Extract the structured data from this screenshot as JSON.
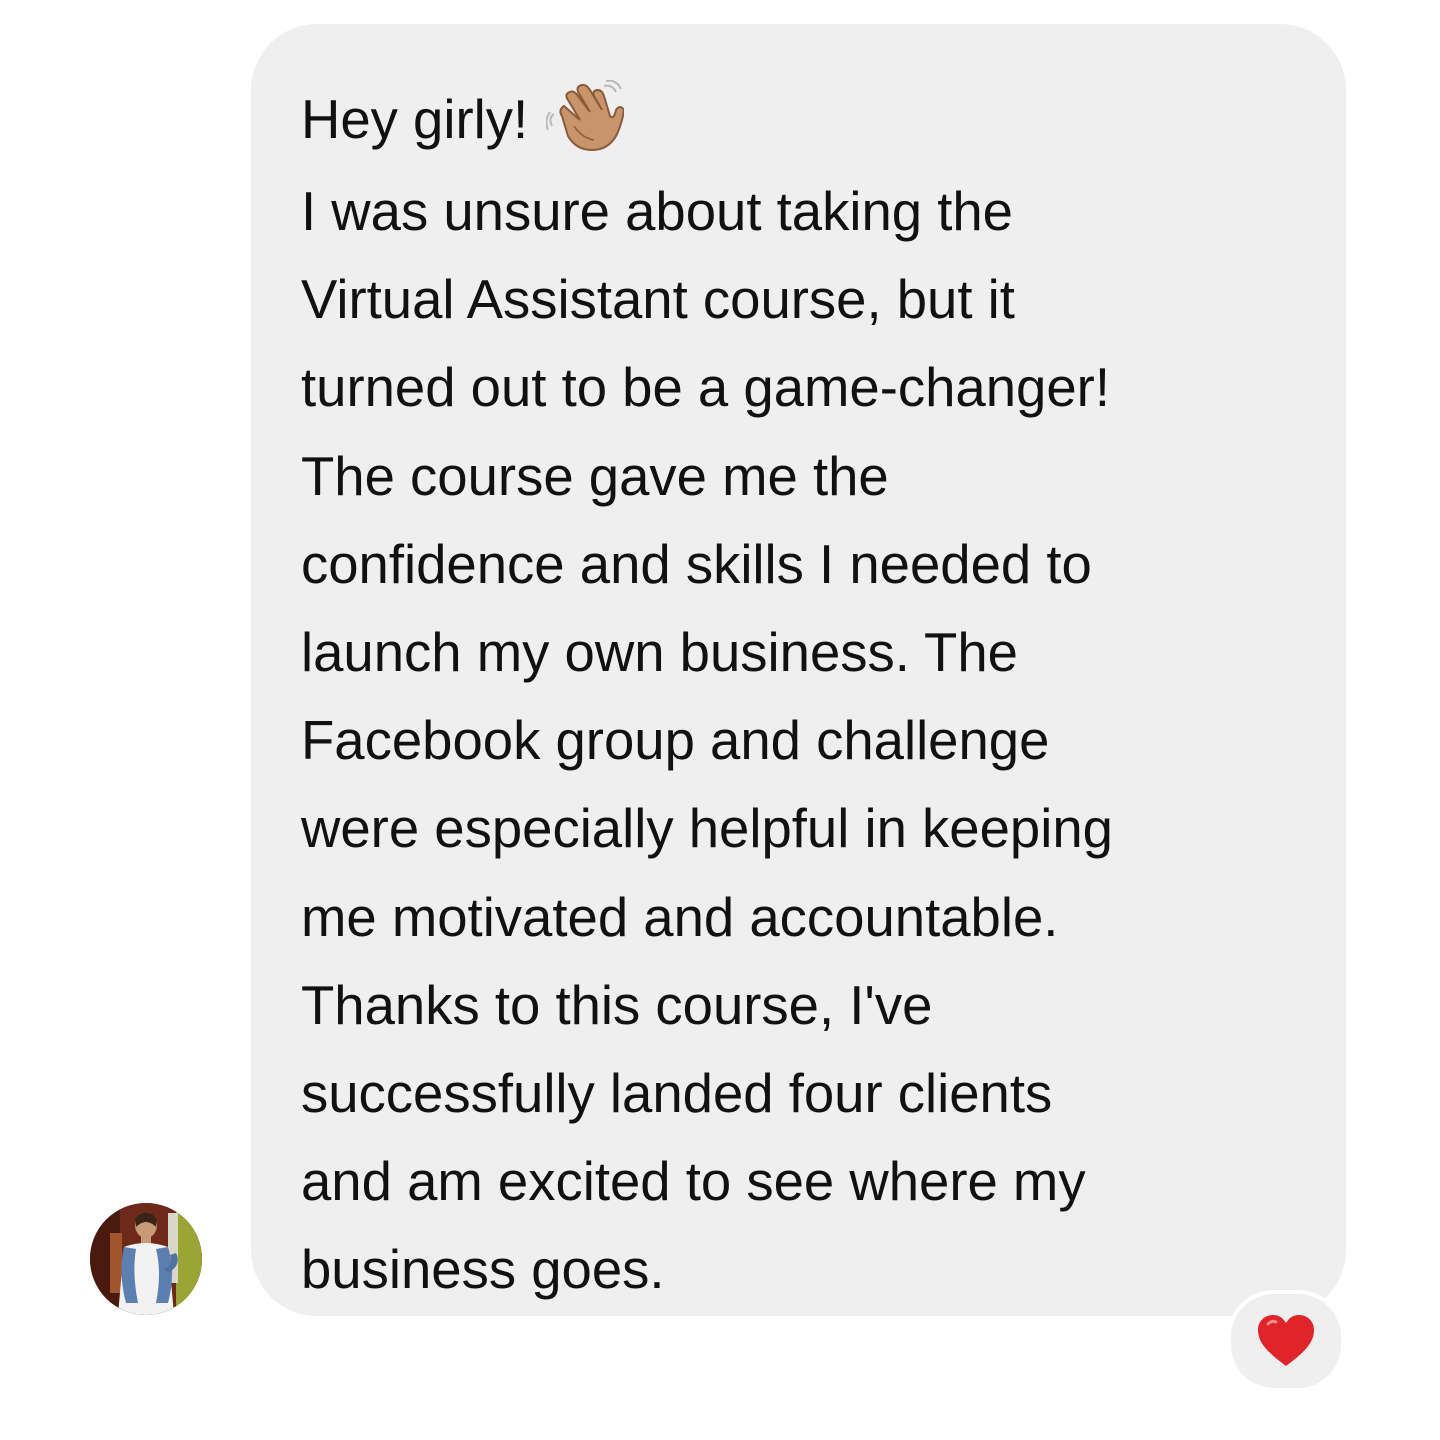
{
  "message": {
    "lines": [
      "Hey girly!",
      "I was unsure about taking the",
      "Virtual Assistant course, but it",
      "turned out to be a game-changer!",
      "The course gave me the",
      "confidence and skills I needed to",
      "launch my own business. The",
      "Facebook group and challenge",
      "were especially helpful in keeping",
      "me motivated and accountable.",
      "Thanks to this course, I've",
      "successfully landed four clients",
      "and am excited to see where my",
      "business goes."
    ],
    "greeting_emoji": "waving-hand-medium-skin-tone-icon",
    "bubble_color": "#efefef",
    "text_color": "#111111"
  },
  "sender": {
    "avatar": "avatar-photo"
  },
  "reaction": {
    "icon": "red-heart-icon",
    "color": "#e0242a"
  }
}
